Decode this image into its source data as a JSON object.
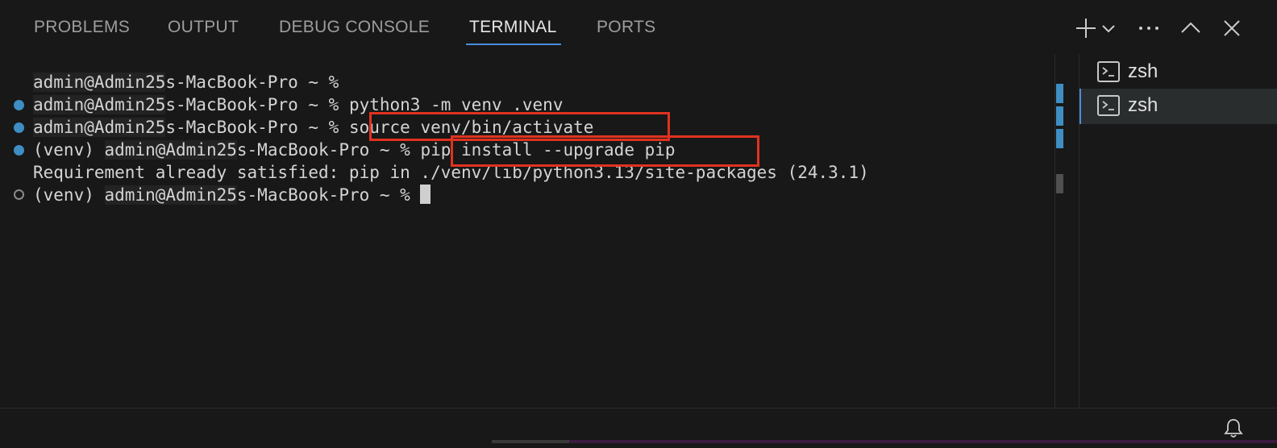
{
  "tabs": [
    {
      "label": "PROBLEMS"
    },
    {
      "label": "OUTPUT"
    },
    {
      "label": "DEBUG CONSOLE"
    },
    {
      "label": "TERMINAL"
    },
    {
      "label": "PORTS"
    }
  ],
  "active_tab": "TERMINAL",
  "actions": {
    "new_terminal_icon": "plus-icon",
    "launch_profile_icon": "chevron-down-icon",
    "more_icon": "ellipsis-icon",
    "maximize_icon": "chevron-up-icon",
    "close_icon": "close-icon"
  },
  "terminal": {
    "lines": [
      {
        "prefix": "",
        "user": "admin@Admin25",
        "rest": "s-MacBook-Pro ~ % ",
        "command": "",
        "status": "none"
      },
      {
        "prefix": "",
        "user": "admin@Admin25",
        "rest": "s-MacBook-Pro ~ % ",
        "command": "python3 -m venv .venv",
        "status": "success"
      },
      {
        "prefix": "",
        "user": "admin@Admin25",
        "rest": "s-MacBook-Pro ~ % ",
        "command": "source venv/bin/activate",
        "status": "success"
      },
      {
        "prefix": "(venv) ",
        "user": "admin@Admin25",
        "rest": "s-MacBook-Pro ~ % ",
        "command": "pip install --upgrade pip",
        "status": "success"
      },
      {
        "output": "Requirement already satisfied: pip in ./venv/lib/python3.13/site-packages (24.3.1)"
      },
      {
        "prefix": "(venv) ",
        "user": "admin@Admin25",
        "rest": "s-MacBook-Pro ~ % ",
        "command": "",
        "status": "pending"
      }
    ]
  },
  "side_panel": {
    "items": [
      {
        "label": "zsh",
        "icon": "terminal-icon"
      },
      {
        "label": "zsh",
        "icon": "terminal-icon"
      }
    ],
    "active_index": 1
  },
  "colors": {
    "background": "#181818",
    "accent": "#4a8ddb",
    "highlight_box": "#e0321f",
    "decoration_success": "#3e8ec4"
  },
  "status_bar": {
    "bell_icon": "bell-icon"
  }
}
